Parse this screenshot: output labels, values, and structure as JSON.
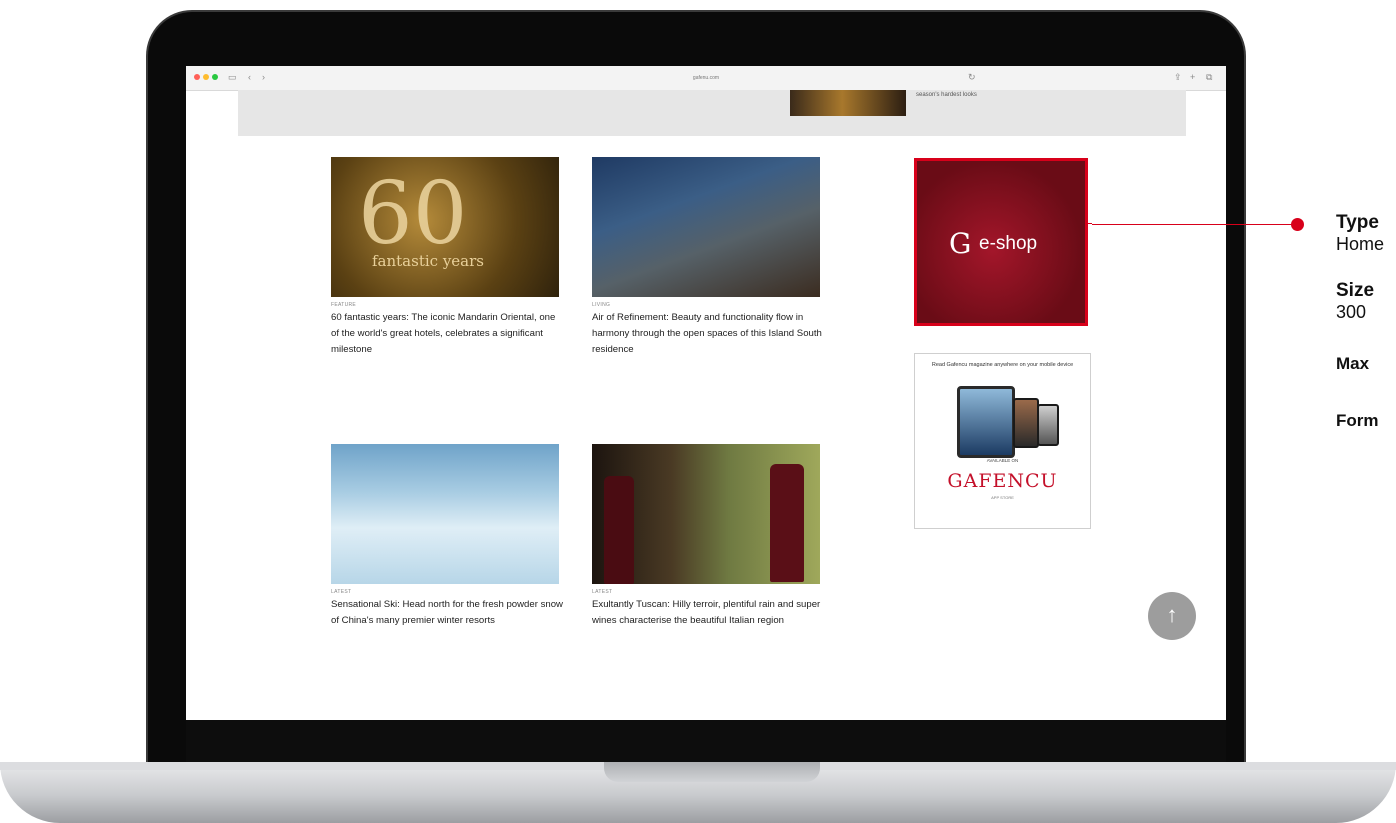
{
  "browser": {
    "url": "gafenu.com",
    "icons": [
      "sidebar-icon",
      "back-icon",
      "forward-icon",
      "reload-icon",
      "share-icon",
      "new-tab-icon",
      "tabs-icon"
    ]
  },
  "banner": {
    "text": "season's hardest looks"
  },
  "articles": [
    {
      "category": "FEATURE",
      "title": "60 fantastic years: The iconic Mandarin Oriental, one of the world's great hotels, celebrates a significant milestone",
      "image_text": "60",
      "image_subtext": "fantastic years"
    },
    {
      "category": "LIVING",
      "title": "Air of Refinement: Beauty and functionality flow in harmony through the open spaces of this Island South residence"
    },
    {
      "category": "LATEST",
      "title": "Sensational Ski: Head north for the fresh powder snow of China's many premier winter resorts"
    },
    {
      "category": "LATEST",
      "title": "Exultantly Tuscan: Hilly terroir, plentiful rain and super wines characterise the beautiful Italian region"
    }
  ],
  "ads": {
    "eshop": {
      "logo": "G",
      "label": "e-shop"
    },
    "magazine": {
      "headline": "Read Gafencu magazine anywhere on your mobile device",
      "small": "AVAILABLE ON",
      "logo": "GAFENCU",
      "tag": "APP STORE"
    }
  },
  "scroll_top": {
    "label": "↑"
  },
  "spec": {
    "type_label": "Type",
    "type_value": "Home",
    "size_label": "Size",
    "size_value": "300",
    "max_label": "Max",
    "format_label": "Form"
  },
  "colors": {
    "accent": "#d8001a",
    "scroll_button": "#9d9d9d"
  }
}
